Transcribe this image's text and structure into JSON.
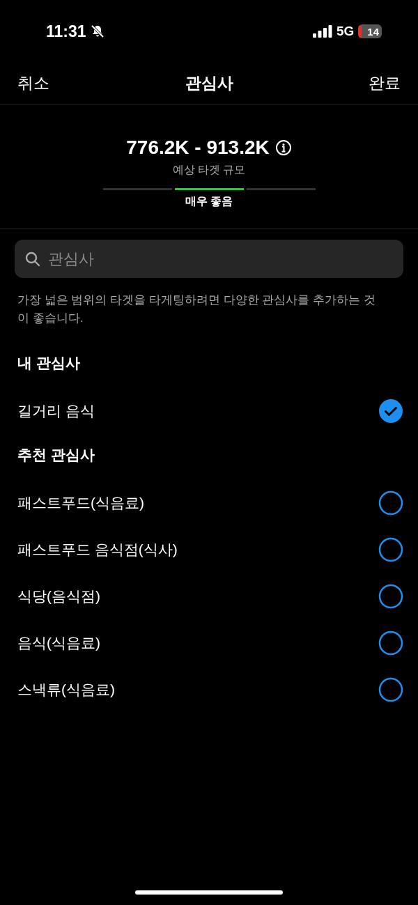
{
  "status_bar": {
    "time": "11:31",
    "network": "5G",
    "battery": "14"
  },
  "nav": {
    "cancel": "취소",
    "title": "관심사",
    "done": "완료"
  },
  "audience": {
    "range": "776.2K - 913.2K",
    "caption": "예상 타겟 규모",
    "segments": [
      {
        "selected": false
      },
      {
        "selected": true
      },
      {
        "selected": false
      }
    ],
    "rating": "매우 좋음"
  },
  "search": {
    "placeholder": "관심사"
  },
  "hint": "가장 넓은 범위의 타겟을 타게팅하려면 다양한 관심사를 추가하는 것이 좋습니다.",
  "sections": [
    {
      "heading": "내 관심사",
      "items": [
        {
          "label": "길거리 음식",
          "checked": true
        }
      ]
    },
    {
      "heading": "추천 관심사",
      "items": [
        {
          "label": "패스트푸드(식음료)",
          "checked": false
        },
        {
          "label": "패스트푸드 음식점(식사)",
          "checked": false
        },
        {
          "label": "식당(음식점)",
          "checked": false
        },
        {
          "label": "음식(식음료)",
          "checked": false
        },
        {
          "label": "스낵류(식음료)",
          "checked": false
        }
      ]
    }
  ]
}
